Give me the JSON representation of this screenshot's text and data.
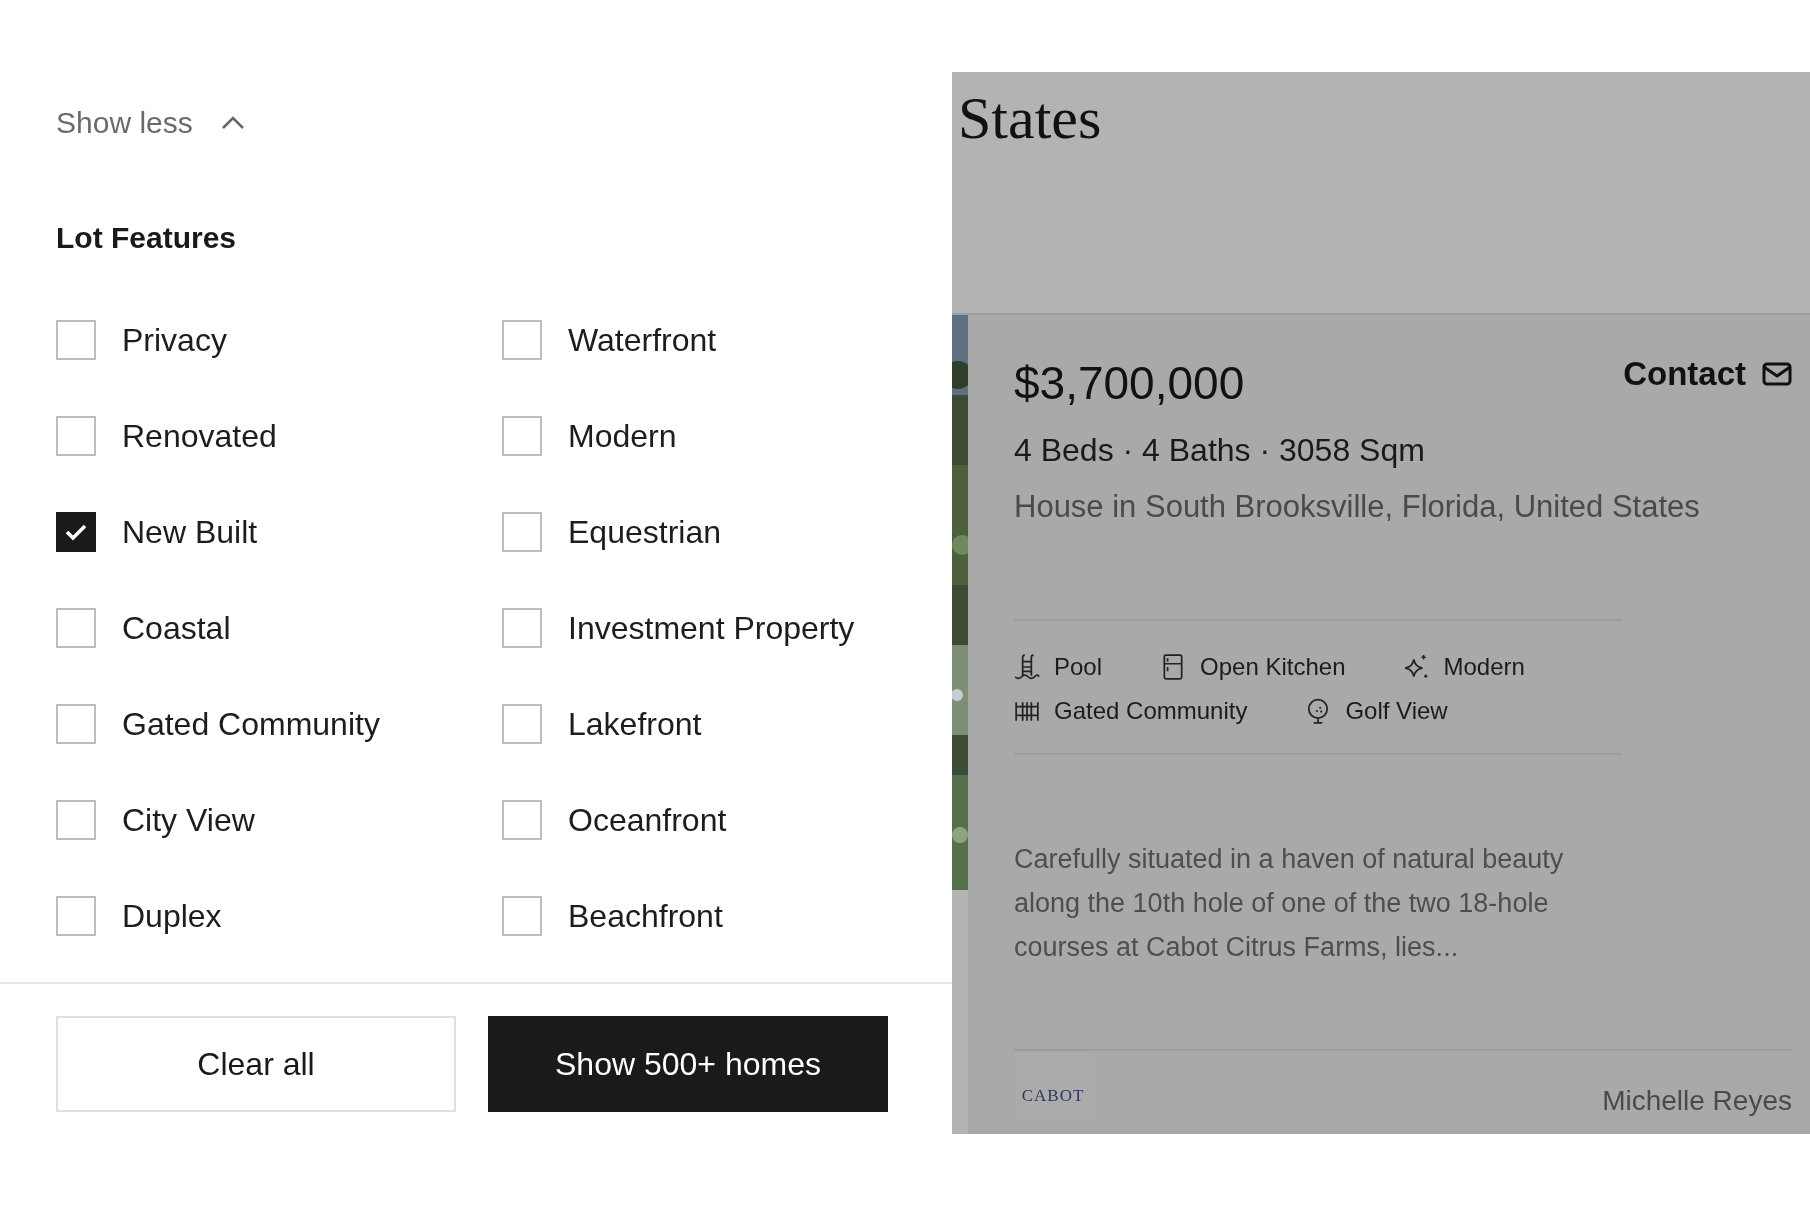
{
  "filter_panel": {
    "show_less": "Show less",
    "section_title": "Lot Features",
    "options": [
      {
        "label": "Privacy",
        "checked": false
      },
      {
        "label": "Waterfront",
        "checked": false
      },
      {
        "label": "Renovated",
        "checked": false
      },
      {
        "label": "Modern",
        "checked": false
      },
      {
        "label": "New Built",
        "checked": true
      },
      {
        "label": "Equestrian",
        "checked": false
      },
      {
        "label": "Coastal",
        "checked": false
      },
      {
        "label": "Investment Property",
        "checked": false
      },
      {
        "label": "Gated Community",
        "checked": false
      },
      {
        "label": "Lakefront",
        "checked": false
      },
      {
        "label": "City View",
        "checked": false
      },
      {
        "label": "Oceanfront",
        "checked": false
      },
      {
        "label": "Duplex",
        "checked": false
      },
      {
        "label": "Beachfront",
        "checked": false
      }
    ],
    "buttons": [
      {
        "label": "Clear all",
        "kind": "outline"
      },
      {
        "label": "Show 500+ homes",
        "kind": "primary"
      }
    ]
  },
  "listing": {
    "heading": "States",
    "price": "$3,700,000",
    "contact": "Contact",
    "specs": "4 Beds · 4 Baths · 3058 Sqm",
    "address": "House in South Brooksville, Florida, United States",
    "features": [
      [
        "Pool",
        "Open Kitchen",
        "Modern"
      ],
      [
        "Gated Community",
        "Golf View"
      ]
    ],
    "description": "Carefully situated in a haven of natural beauty along the 10th hole of one of the two 18-hole courses at Cabot Citrus Farms, lies...",
    "brand_logo": "CABOT",
    "agent": "Michelle Reyes"
  }
}
